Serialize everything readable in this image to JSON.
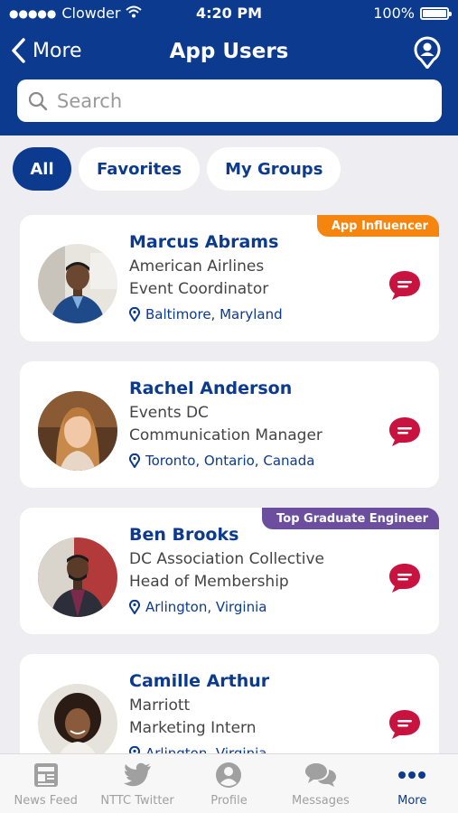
{
  "status_bar": {
    "carrier": "Clowder",
    "time": "4:20 PM",
    "battery": "100%"
  },
  "nav": {
    "back_label": "More",
    "title": "App Users"
  },
  "search": {
    "placeholder": "Search"
  },
  "filters": [
    "All",
    "Favorites",
    "My Groups"
  ],
  "users": [
    {
      "name": "Marcus Abrams",
      "line1": "American Airlines",
      "line2": "Event Coordinator",
      "location": "Baltimore, Maryland",
      "badge": "App Influencer"
    },
    {
      "name": "Rachel Anderson",
      "line1": "Events DC",
      "line2": "Communication Manager",
      "location": "Toronto, Ontario, Canada",
      "badge": ""
    },
    {
      "name": "Ben Brooks",
      "line1": "DC Association Collective",
      "line2": "Head of Membership",
      "location": "Arlington, Virginia",
      "badge": "Top Graduate Engineer"
    },
    {
      "name": "Camille Arthur",
      "line1": "Marriott",
      "line2": "Marketing Intern",
      "location": "Arlington, Virginia",
      "badge": ""
    }
  ],
  "tabbar": {
    "news_feed": "News Feed",
    "twitter": "NTTC Twitter",
    "profile": "Profile",
    "messages": "Messages",
    "more": "More"
  },
  "colors": {
    "brand_blue": "#0b3a8f",
    "chat_red": "#c8123f",
    "badge_orange": "#f5850f",
    "badge_purple": "#6b4f9e"
  }
}
